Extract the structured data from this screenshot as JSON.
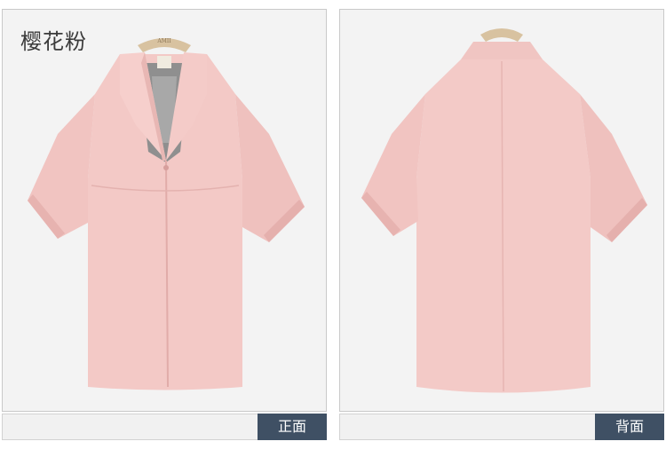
{
  "color_name": "樱花粉",
  "front_label": "正面",
  "back_label": "背面",
  "hanger_brand": "AMII"
}
